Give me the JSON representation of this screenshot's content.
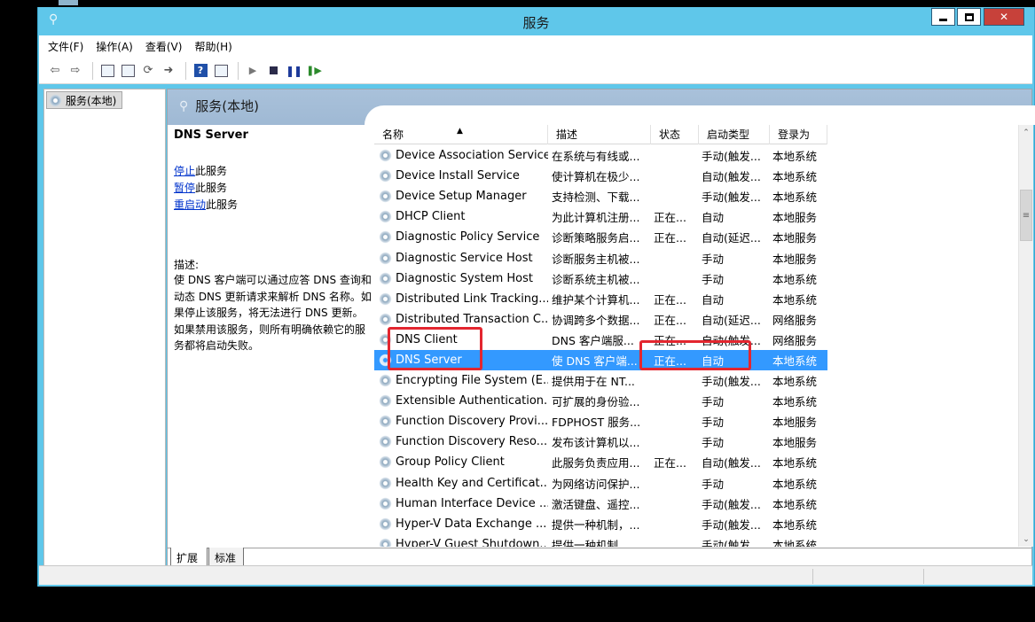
{
  "window": {
    "title": "服务"
  },
  "menu": {
    "items": [
      "文件(F)",
      "操作(A)",
      "查看(V)",
      "帮助(H)"
    ]
  },
  "tree": {
    "root_label": "服务(本地)"
  },
  "pane": {
    "header_title": "服务(本地)",
    "selected_service": "DNS Server",
    "actions": [
      {
        "link": "停止",
        "suffix": "此服务"
      },
      {
        "link": "暂停",
        "suffix": "此服务"
      },
      {
        "link": "重启动",
        "suffix": "此服务"
      }
    ],
    "desc_label": "描述:",
    "description": "使 DNS 客户端可以通过应答 DNS 查询和动态 DNS 更新请求来解析 DNS 名称。如果停止该服务，将无法进行 DNS 更新。如果禁用该服务，则所有明确依赖它的服务都将启动失败。"
  },
  "columns": [
    "名称",
    "描述",
    "状态",
    "启动类型",
    "登录为"
  ],
  "rows": [
    [
      "Device Association Service",
      "在系统与有线或...",
      "",
      "手动(触发...",
      "本地系统"
    ],
    [
      "Device Install Service",
      "使计算机在极少...",
      "",
      "自动(触发...",
      "本地系统"
    ],
    [
      "Device Setup Manager",
      "支持检测、下载...",
      "",
      "手动(触发...",
      "本地系统"
    ],
    [
      "DHCP Client",
      "为此计算机注册...",
      "正在...",
      "自动",
      "本地服务"
    ],
    [
      "Diagnostic Policy Service",
      "诊断策略服务启...",
      "正在...",
      "自动(延迟...",
      "本地服务"
    ],
    [
      "Diagnostic Service Host",
      "诊断服务主机被...",
      "",
      "手动",
      "本地服务"
    ],
    [
      "Diagnostic System Host",
      "诊断系统主机被...",
      "",
      "手动",
      "本地系统"
    ],
    [
      "Distributed Link Tracking...",
      "维护某个计算机...",
      "正在...",
      "自动",
      "本地系统"
    ],
    [
      "Distributed Transaction C...",
      "协调跨多个数据...",
      "正在...",
      "自动(延迟...",
      "网络服务"
    ],
    [
      "DNS Client",
      "DNS 客户端服...",
      "正在...",
      "自动(触发...",
      "网络服务"
    ],
    [
      "DNS Server",
      "使 DNS 客户端...",
      "正在...",
      "自动",
      "本地系统"
    ],
    [
      "Encrypting File System (E...",
      "提供用于在 NT...",
      "",
      "手动(触发...",
      "本地系统"
    ],
    [
      "Extensible Authentication...",
      "可扩展的身份验...",
      "",
      "手动",
      "本地系统"
    ],
    [
      "Function Discovery Provi...",
      "FDPHOST 服务...",
      "",
      "手动",
      "本地服务"
    ],
    [
      "Function Discovery Reso...",
      "发布该计算机以...",
      "",
      "手动",
      "本地服务"
    ],
    [
      "Group Policy Client",
      "此服务负责应用...",
      "正在...",
      "自动(触发...",
      "本地系统"
    ],
    [
      "Health Key and Certificat...",
      "为网络访问保护...",
      "",
      "手动",
      "本地系统"
    ],
    [
      "Human Interface Device ...",
      "激活键盘、遥控...",
      "",
      "手动(触发...",
      "本地系统"
    ],
    [
      "Hyper-V Data Exchange ...",
      "提供一种机制，...",
      "",
      "手动(触发...",
      "本地系统"
    ],
    [
      "Hyper-V Guest Shutdown...",
      "提供一种机制，...",
      "",
      "手动(触发...",
      "本地系统"
    ]
  ],
  "selected_row_index": 10,
  "tabs": [
    "扩展",
    "标准"
  ],
  "colors": {
    "titlebar": "#5fc7ea",
    "selection": "#3399ff",
    "highlight": "#e3262f",
    "close": "#c7413a"
  }
}
